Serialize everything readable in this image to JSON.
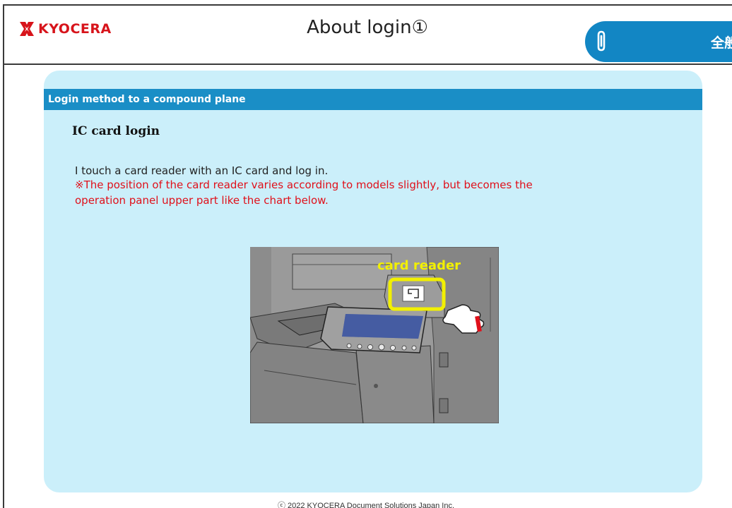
{
  "header": {
    "logo_text": "KYOCERA",
    "title": "About login①",
    "tag_icon": "paperclip-icon",
    "tag_label": "全般"
  },
  "section": {
    "heading": "Login method to a compound plane",
    "subheading": "IC card login",
    "body": "I touch a card reader with an IC card and log in.",
    "note_line1": "※The position of the card reader varies according to models slightly, but becomes the",
    "note_line2": "operation panel upper part like the chart below."
  },
  "illustration": {
    "callout_label": "card reader",
    "icon": "card-reader-icon"
  },
  "footer": {
    "copyright": "ⓒ 2022 KYOCERA Document Solutions Japan Inc."
  },
  "colors": {
    "brand_red": "#d7141b",
    "accent_blue": "#1286c4",
    "panel_bg": "#cbeffa",
    "note_red": "#e0101a",
    "callout_yellow": "#f2f000"
  }
}
